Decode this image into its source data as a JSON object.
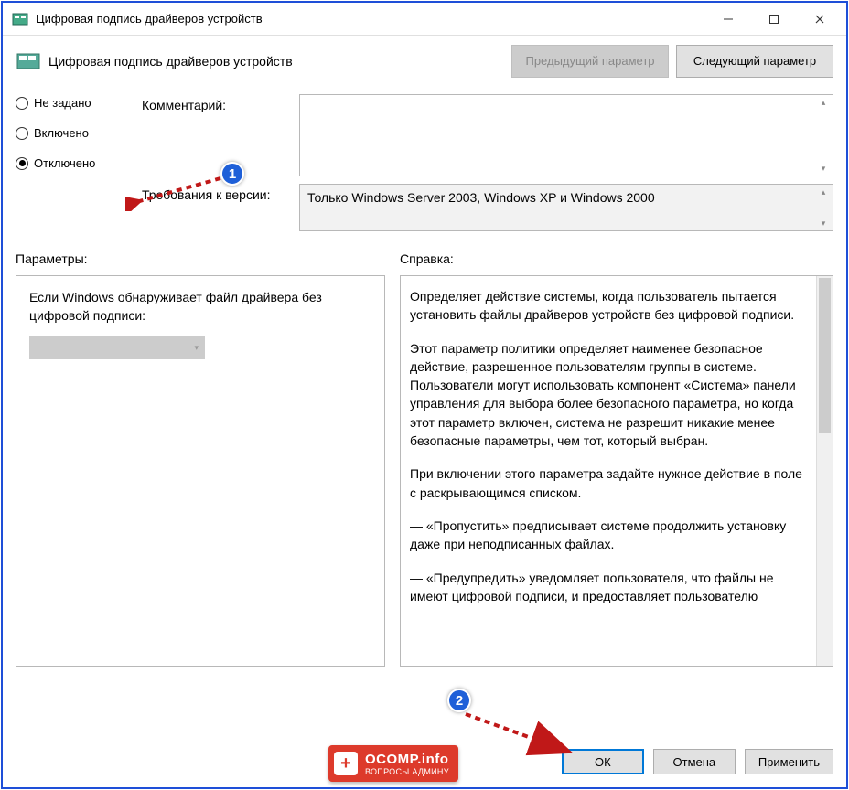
{
  "window": {
    "title": "Цифровая подпись драйверов устройств"
  },
  "header": {
    "title": "Цифровая подпись драйверов устройств",
    "prev_button": "Предыдущий параметр",
    "next_button": "Следующий параметр"
  },
  "radios": {
    "not_configured": "Не задано",
    "enabled": "Включено",
    "disabled": "Отключено"
  },
  "fields": {
    "comment_label": "Комментарий:",
    "version_label": "Требования к версии:",
    "version_text": "Только Windows Server 2003, Windows XP и Windows 2000"
  },
  "sections": {
    "params": "Параметры:",
    "help": "Справка:"
  },
  "params": {
    "text": "Если Windows обнаруживает файл драйвера без цифровой подписи:"
  },
  "help": {
    "p1": "Определяет действие системы, когда пользователь пытается установить файлы драйверов устройств без цифровой подписи.",
    "p2": "Этот параметр политики определяет наименее безопасное действие, разрешенное пользователям группы в системе. Пользователи могут использовать компонент «Система» панели управления для выбора более безопасного параметра, но когда этот параметр включен, система не разрешит никакие менее безопасные параметры, чем тот, который выбран.",
    "p3": "При включении этого параметра задайте нужное действие в поле с раскрывающимся списком.",
    "p4": "— «Пропустить» предписывает системе продолжить установку даже при неподписанных файлах.",
    "p5": "— «Предупредить» уведомляет пользователя, что файлы не имеют цифровой подписи, и предоставляет пользователю"
  },
  "buttons": {
    "ok": "ОК",
    "cancel": "Отмена",
    "apply": "Применить"
  },
  "logo": {
    "line1": "OCOMP.info",
    "line2": "ВОПРОСЫ АДМИНУ"
  },
  "annotations": {
    "badge1": "1",
    "badge2": "2"
  }
}
